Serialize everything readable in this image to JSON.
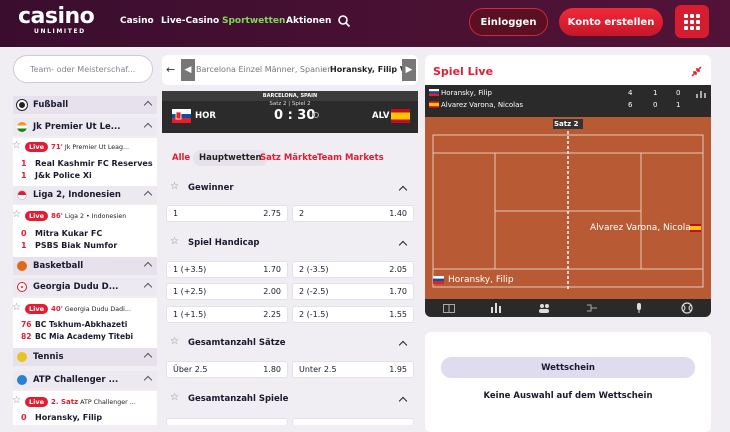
{
  "header": {
    "logo": "casino",
    "logo_sub": "UNLIMITED",
    "nav": [
      "Casino",
      "Live-Casino",
      "Sportwetten",
      "Aktionen"
    ],
    "login": "Einloggen",
    "register": "Konto erstellen"
  },
  "left": {
    "search_placeholder": "Team- oder Meisterschaf...",
    "groups": [
      {
        "label": "Fußball"
      },
      {
        "label": "Jk Premier Ut Le...",
        "match": {
          "live": "Live",
          "time": "71'",
          "league": "Jk Premier Ut Leag...",
          "teams": [
            {
              "score": "1",
              "name": "Real Kashmir FC Reserves"
            },
            {
              "score": "1",
              "name": "J&k Police Xi"
            }
          ]
        }
      },
      {
        "label": "Liga 2, Indonesien",
        "match": {
          "live": "Live",
          "time": "86'",
          "league": "Liga 2 • Indonesien",
          "teams": [
            {
              "score": "0",
              "name": "Mitra Kukar FC"
            },
            {
              "score": "1",
              "name": "PSBS Biak Numfor"
            }
          ]
        }
      },
      {
        "label": "Basketball"
      },
      {
        "label": "Georgia Dudu D...",
        "match": {
          "live": "Live",
          "time": "40'",
          "league": "Georgia Dudu Dadi...",
          "teams": [
            {
              "score": "76",
              "name": "BC Tskhum-Abkhazeti"
            },
            {
              "score": "82",
              "name": "BC Mia Academy Titebi"
            }
          ]
        }
      },
      {
        "label": "Tennis"
      },
      {
        "label": "ATP Challenger ...",
        "match": {
          "live": "Live",
          "time": "2. Satz",
          "league": "ATP Challenger ...",
          "teams": [
            {
              "score": "0",
              "name": "Horansky, Filip"
            }
          ]
        }
      }
    ]
  },
  "mid": {
    "breadcrumb": "Barcelona Einzel Männer, Spanien",
    "breadcrumb_current": "Horansky, Filip Vs.",
    "venue": "BARCELONA, SPAIN",
    "set_info": "Satz 2 | Spiel 2",
    "home": "HOR",
    "away": "ALV",
    "score": "0 : 30",
    "tabs": [
      "Alle",
      "Hauptwetten",
      "Satz Märkte",
      "Team Markets"
    ],
    "markets": [
      {
        "title": "Gewinner",
        "odds": [
          [
            "1",
            "2.75"
          ],
          [
            "2",
            "1.40"
          ]
        ]
      },
      {
        "title": "Spiel Handicap",
        "odds": [
          [
            "1 (+3.5)",
            "1.70"
          ],
          [
            "2 (-3.5)",
            "2.05"
          ],
          [
            "1 (+2.5)",
            "2.00"
          ],
          [
            "2 (-2.5)",
            "1.70"
          ],
          [
            "1 (+1.5)",
            "2.25"
          ],
          [
            "2 (-1.5)",
            "1.55"
          ]
        ]
      },
      {
        "title": "Gesamtanzahl Sätze",
        "odds": [
          [
            "Über 2.5",
            "1.80"
          ],
          [
            "Unter 2.5",
            "1.95"
          ]
        ]
      },
      {
        "title": "Gesamtanzahl Spiele",
        "odds": []
      }
    ]
  },
  "right": {
    "title": "Spiel Live",
    "players": [
      {
        "name": "Horansky, Filip",
        "s1": "4",
        "s2": "1",
        "pts": "0"
      },
      {
        "name": "Alvarez Varona, Nicolas",
        "s1": "6",
        "s2": "0",
        "pts": "1"
      }
    ],
    "set_label": "Satz 2",
    "court_top": "Alvarez Varona, Nicolas",
    "court_bottom": "Horansky, Filip"
  },
  "betslip": {
    "button": "Wettschein",
    "empty": "Keine Auswahl auf dem Wettschein"
  },
  "colors": {
    "header": "#4a1133",
    "accent": "#e21d33",
    "green": "#7ed957",
    "court": "#b85b35"
  }
}
